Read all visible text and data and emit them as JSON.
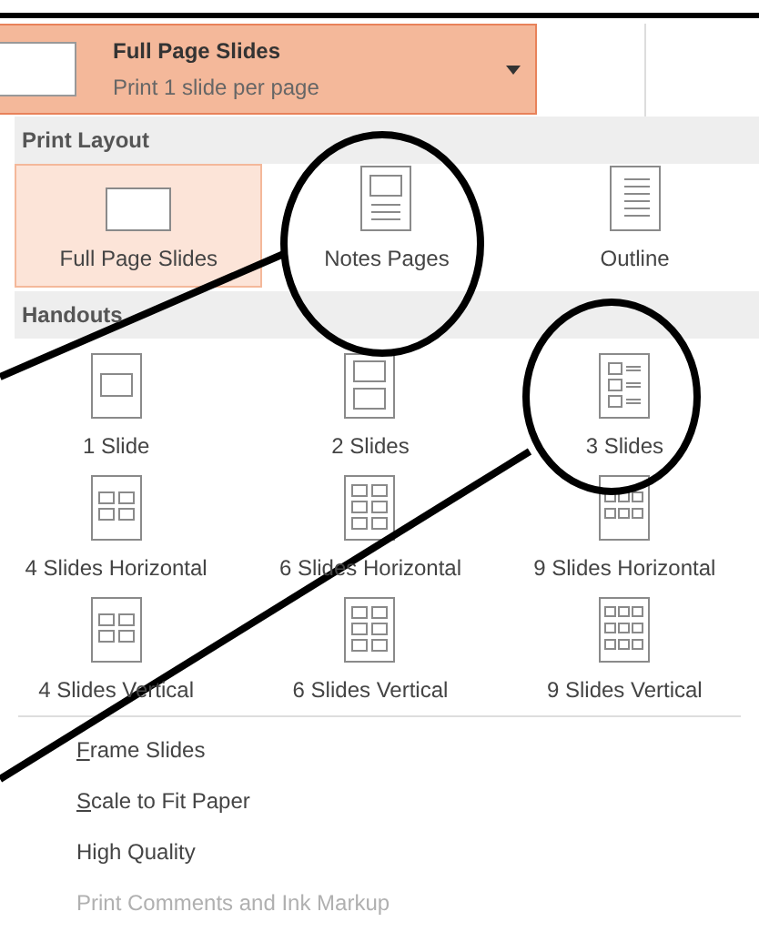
{
  "dropdown": {
    "title": "Full Page Slides",
    "subtitle": "Print 1 slide per page"
  },
  "print_layout": {
    "header": "Print Layout",
    "items": [
      {
        "label": "Full Page Slides",
        "selected": true,
        "kind": "full"
      },
      {
        "label": "Notes Pages",
        "selected": false,
        "kind": "notes"
      },
      {
        "label": "Outline",
        "selected": false,
        "kind": "outline"
      }
    ]
  },
  "handouts": {
    "header": "Handouts",
    "items": [
      {
        "label": "1 Slide",
        "kind": "h1"
      },
      {
        "label": "2 Slides",
        "kind": "h2"
      },
      {
        "label": "3 Slides",
        "kind": "h3"
      },
      {
        "label": "4 Slides Horizontal",
        "kind": "h4h"
      },
      {
        "label": "6 Slides Horizontal",
        "kind": "h6h"
      },
      {
        "label": "9 Slides Horizontal",
        "kind": "h9h"
      },
      {
        "label": "4 Slides Vertical",
        "kind": "h4v"
      },
      {
        "label": "6 Slides Vertical",
        "kind": "h6v"
      },
      {
        "label": "9 Slides Vertical",
        "kind": "h9v"
      }
    ]
  },
  "options": [
    {
      "access_key": "F",
      "rest": "rame Slides",
      "disabled": false
    },
    {
      "access_key": "S",
      "rest": "cale to Fit Paper",
      "disabled": false
    },
    {
      "label": "High Quality",
      "disabled": false
    },
    {
      "label": "Print Comments and Ink Markup",
      "disabled": true
    }
  ]
}
